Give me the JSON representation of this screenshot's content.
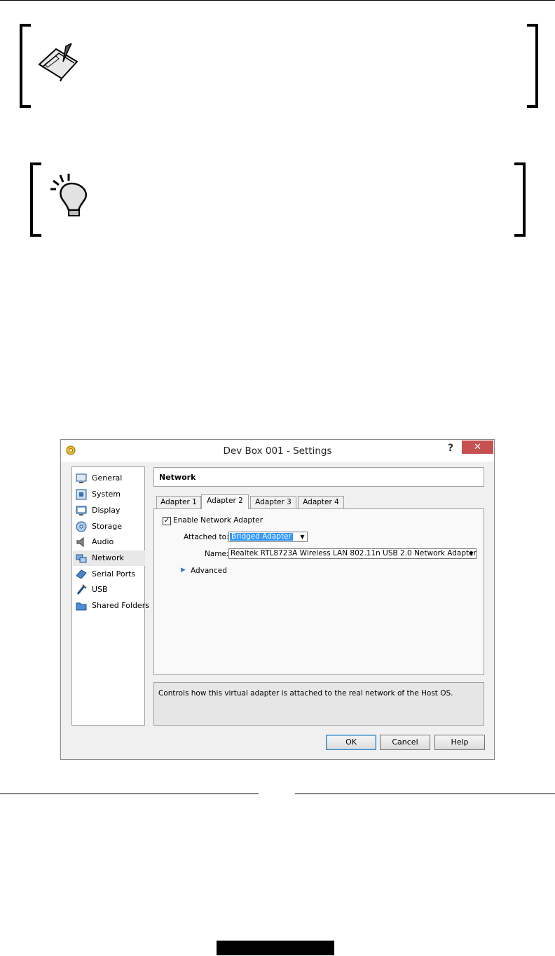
{
  "dialog": {
    "title": "Dev Box 001 - Settings",
    "help_label": "?",
    "close_label": "✕",
    "sidebar": {
      "items": [
        {
          "label": "General",
          "icon": "general-icon"
        },
        {
          "label": "System",
          "icon": "system-icon"
        },
        {
          "label": "Display",
          "icon": "display-icon"
        },
        {
          "label": "Storage",
          "icon": "storage-icon"
        },
        {
          "label": "Audio",
          "icon": "audio-icon"
        },
        {
          "label": "Network",
          "icon": "network-icon",
          "selected": true
        },
        {
          "label": "Serial Ports",
          "icon": "serial-ports-icon"
        },
        {
          "label": "USB",
          "icon": "usb-icon"
        },
        {
          "label": "Shared Folders",
          "icon": "shared-folders-icon"
        }
      ]
    },
    "section_title": "Network",
    "tabs": [
      {
        "label": "Adapter 1"
      },
      {
        "label": "Adapter 2",
        "active": true
      },
      {
        "label": "Adapter 3"
      },
      {
        "label": "Adapter 4"
      }
    ],
    "enable_adapter": {
      "label": "Enable Network Adapter",
      "checked": true,
      "check_glyph": "✓"
    },
    "attached_to": {
      "label": "Attached to:",
      "value": "Bridged Adapter"
    },
    "name": {
      "label": "Name:",
      "value": "Realtek RTL8723A Wireless LAN 802.11n USB 2.0 Network Adapter"
    },
    "advanced": {
      "label": "Advanced",
      "arrow": "▶"
    },
    "description": "Controls how this virtual adapter is attached to the real network of the Host OS.",
    "buttons": {
      "ok": "OK",
      "cancel": "Cancel",
      "help": "Help"
    },
    "dropdown_arrow": "▼"
  },
  "colors": {
    "close_button": "#c75050",
    "selection": "#3399ff",
    "advanced_arrow": "#3a7fd0"
  }
}
